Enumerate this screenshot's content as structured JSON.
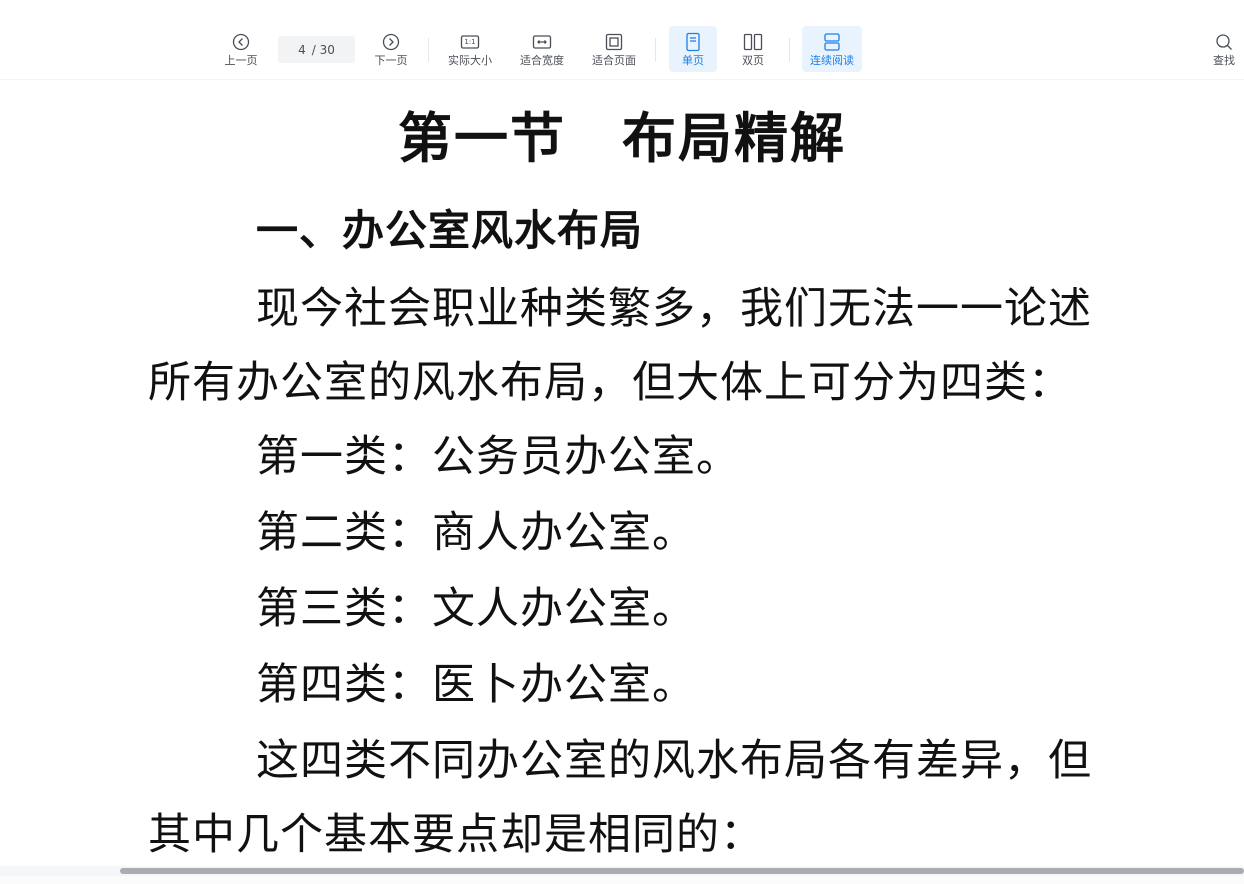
{
  "toolbar": {
    "prev_page_label": "上一页",
    "next_page_label": "下一页",
    "current_page": "4",
    "total_pages": "/ 30",
    "actual_size_label": "实际大小",
    "actual_size_icon_text": "1:1",
    "fit_width_label": "适合宽度",
    "fit_page_label": "适合页面",
    "single_page_label": "单页",
    "two_page_label": "双页",
    "continuous_label": "连续阅读",
    "search_label": "查找",
    "accent_color": "#1f7fe6"
  },
  "document": {
    "title_part1": "第一节",
    "title_part2": "布局精解",
    "lines": [
      "一、办公室风水布局",
      "现今社会职业种类繁多，我们无法一一论述",
      "所有办公室的风水布局，但大体上可分为四类：",
      "第一类：公务员办公室。",
      "第二类：商人办公室。",
      "第三类：文人办公室。",
      "第四类：医卜办公室。",
      "这四类不同办公室的风水布局各有差异，但",
      "其中几个基本要点却是相同的："
    ]
  }
}
